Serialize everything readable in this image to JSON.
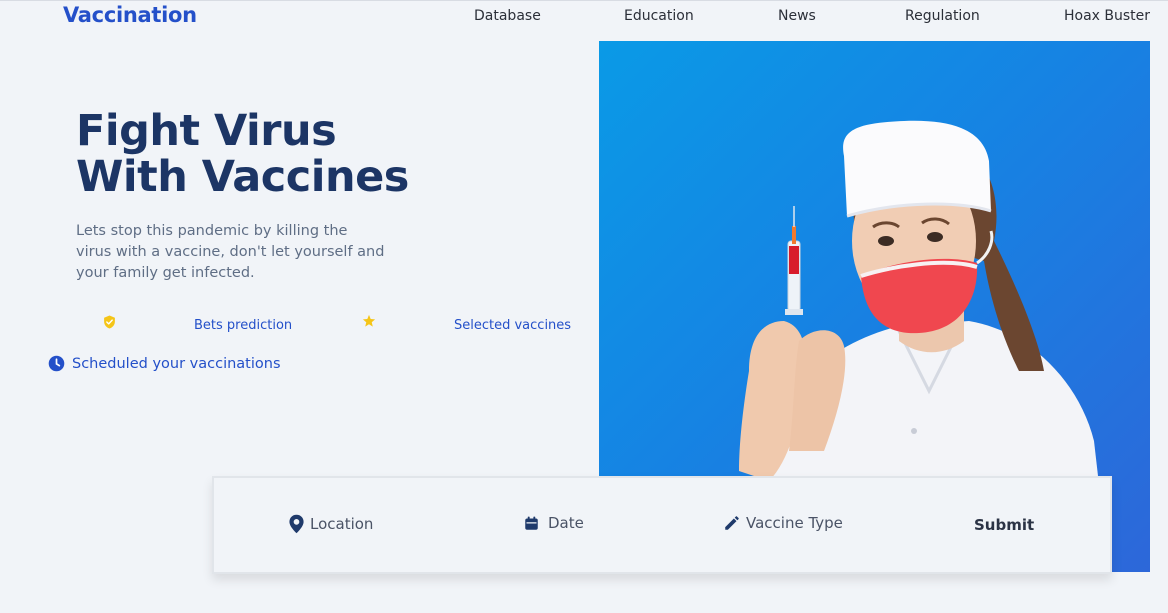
{
  "header": {
    "logo": "Vaccination",
    "nav": [
      "Database",
      "Education",
      "News",
      "Regulation",
      "Hoax Buster"
    ]
  },
  "hero": {
    "title_line1": "Fight Virus",
    "title_line2": "With Vaccines",
    "subtitle": "Lets stop this pandemic by killing the virus with a vaccine, don't let yourself and your family get infected.",
    "features": [
      {
        "label": "Bets prediction",
        "icon": "shield-check-icon"
      },
      {
        "label": "Selected vaccines",
        "icon": "star-icon"
      }
    ],
    "schedule_link": "Scheduled your vaccinations",
    "schedule_icon": "clock-icon",
    "image": "nurse-holding-syringe"
  },
  "booking": {
    "location": "Location",
    "date": "Date",
    "vaccine_type": "Vaccine Type",
    "submit": "Submit"
  },
  "colors": {
    "brand": "#2450c9",
    "title": "#1c3565",
    "accent_yellow": "#f5c518",
    "image_blue": "#1683e3"
  }
}
